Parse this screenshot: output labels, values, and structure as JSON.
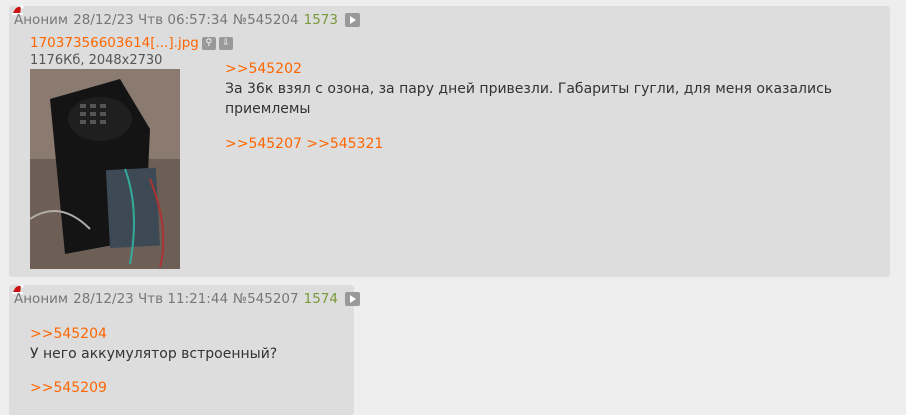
{
  "posts": [
    {
      "author": "Аноним",
      "datetime": "28/12/23 Чтв 06:57:34",
      "number": "№545204",
      "count": "1573",
      "file": {
        "name": "17037356603614[...].jpg",
        "meta": "1176Кб, 2048x2730"
      },
      "reply_to": ">>545202",
      "body": "За 36к взял с озона, за пару дней привезли. Габариты гугли, для меня оказались приемлемы",
      "replies": [
        ">>545207",
        ">>545321"
      ]
    },
    {
      "author": "Аноним",
      "datetime": "28/12/23 Чтв 11:21:44",
      "number": "№545207",
      "count": "1574",
      "reply_to": ">>545204",
      "body": "У него аккумулятор встроенный?",
      "replies": [
        ">>545209"
      ]
    }
  ],
  "colors": {
    "link": "#ff6600",
    "count": "#7a9a3a",
    "post_bg": "#dddddd",
    "page_bg": "#eeeeee"
  }
}
